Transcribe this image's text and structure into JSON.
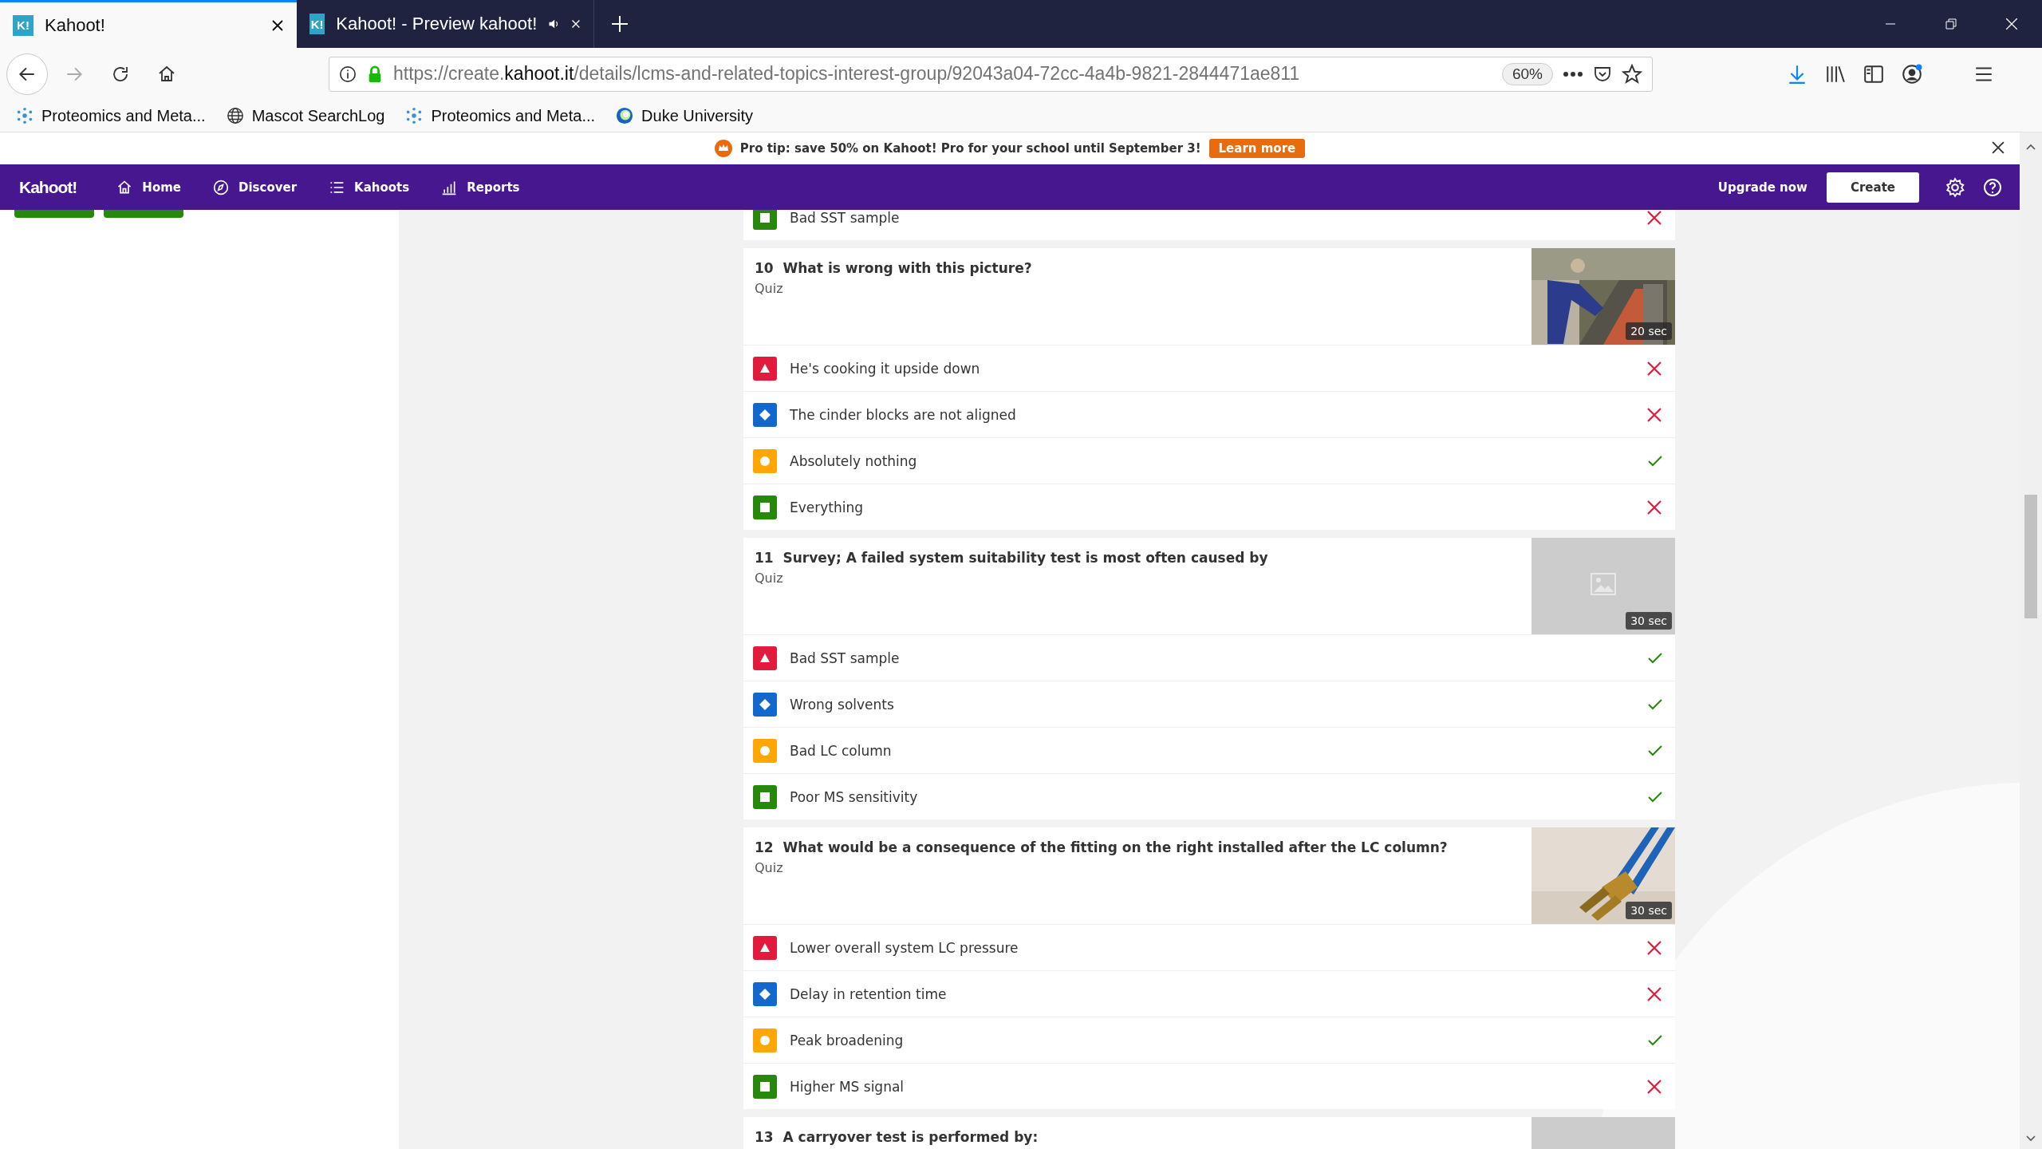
{
  "browser": {
    "tabs": [
      {
        "icon_text": "K!",
        "title": "Kahoot!",
        "selected": true,
        "audio": false
      },
      {
        "icon_text": "K!",
        "title": "Kahoot! - Preview kahoot!",
        "selected": false,
        "audio": true
      }
    ],
    "url": {
      "start": "https://create.",
      "domain": "kahoot.it",
      "path": "/details/lcms-and-related-topics-interest-group/92043a04-72cc-4a4b-9821-2844471ae811"
    },
    "zoom": "60%",
    "bookmarks": [
      {
        "kind": "flake",
        "label": "Proteomics and Meta..."
      },
      {
        "kind": "globe",
        "label": "Mascot SearchLog"
      },
      {
        "kind": "flake",
        "label": "Proteomics and Meta..."
      },
      {
        "kind": "duke",
        "label": "Duke University"
      }
    ]
  },
  "banner": {
    "text": "Pro tip: save 50% on Kahoot! Pro for your school until September 3!",
    "button": "Learn more"
  },
  "nav": {
    "logo": "Kahoot!",
    "items": [
      {
        "label": "Home"
      },
      {
        "label": "Discover"
      },
      {
        "label": "Kahoots"
      },
      {
        "label": "Reports"
      }
    ],
    "upgrade": "Upgrade now",
    "create": "Create"
  },
  "previous_answers": [
    {
      "kind": "square",
      "text": "Bad SST sample",
      "correct": false
    }
  ],
  "questions": [
    {
      "number": "10",
      "title": "What is wrong with this picture?",
      "type": "Quiz",
      "time": "20 sec",
      "answers": [
        {
          "kind": "triangle",
          "text": "He's cooking it upside down",
          "correct": false
        },
        {
          "kind": "diamond",
          "text": "The cinder blocks are not aligned",
          "correct": false
        },
        {
          "kind": "circle",
          "text": "Absolutely nothing",
          "correct": true
        },
        {
          "kind": "square",
          "text": "Everything",
          "correct": false
        }
      ]
    },
    {
      "number": "11",
      "title": "Survey; A failed system suitability test is most often caused by",
      "type": "Quiz",
      "image": {
        "kind": "placeholder"
      },
      "time": "30 sec",
      "answers": [
        {
          "kind": "triangle",
          "text": "Bad SST sample",
          "correct": true
        },
        {
          "kind": "diamond",
          "text": "Wrong solvents",
          "correct": true
        },
        {
          "kind": "circle",
          "text": "Bad LC column",
          "correct": true
        },
        {
          "kind": "square",
          "text": "Poor MS sensitivity",
          "correct": true
        }
      ]
    },
    {
      "number": "12",
      "title": "What would be a consequence of the fitting on the right installed after the LC column?",
      "type": "Quiz",
      "time": "30 sec",
      "answers": [
        {
          "kind": "triangle",
          "text": "Lower overall system LC pressure",
          "correct": false
        },
        {
          "kind": "diamond",
          "text": "Delay in retention time",
          "correct": false
        },
        {
          "kind": "circle",
          "text": "Peak broadening",
          "correct": true
        },
        {
          "kind": "square",
          "text": "Higher MS signal",
          "correct": false
        }
      ]
    },
    {
      "number": "13",
      "title": "A carryover test is performed by:",
      "image": {
        "kind": "blank"
      }
    }
  ]
}
